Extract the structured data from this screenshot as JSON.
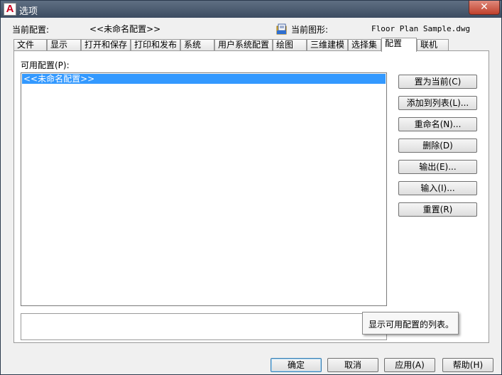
{
  "window": {
    "title": "选项",
    "close_label": "✕",
    "app_icon_letter": "A"
  },
  "header": {
    "current_profile_label": "当前配置:",
    "current_profile_value": "<<未命名配置>>",
    "current_drawing_label": "当前图形:",
    "current_drawing_value": "Floor Plan Sample.dwg"
  },
  "tabs": [
    {
      "label": "文件"
    },
    {
      "label": "显示"
    },
    {
      "label": "打开和保存"
    },
    {
      "label": "打印和发布"
    },
    {
      "label": "系统"
    },
    {
      "label": "用户系统配置"
    },
    {
      "label": "绘图"
    },
    {
      "label": "三维建模"
    },
    {
      "label": "选择集"
    },
    {
      "label": "配置",
      "active": true
    },
    {
      "label": "联机"
    }
  ],
  "profiles": {
    "label": "可用配置(P):",
    "items": [
      "<<未命名配置>>"
    ],
    "selected_index": 0
  },
  "actions": {
    "set_current": "置为当前(C)",
    "add_to_list": "添加到列表(L)...",
    "rename": "重命名(N)...",
    "delete": "删除(D)",
    "export": "输出(E)...",
    "import": "输入(I)...",
    "reset": "重置(R)"
  },
  "tooltip": "显示可用配置的列表。",
  "footer": {
    "ok": "确定",
    "cancel": "取消",
    "apply": "应用(A)",
    "help": "帮助(H)"
  },
  "colors": {
    "selection": "#3399ff",
    "titlebar": "#4a5a6e",
    "close_button": "#c75040",
    "autocad_red": "#c8001e"
  }
}
